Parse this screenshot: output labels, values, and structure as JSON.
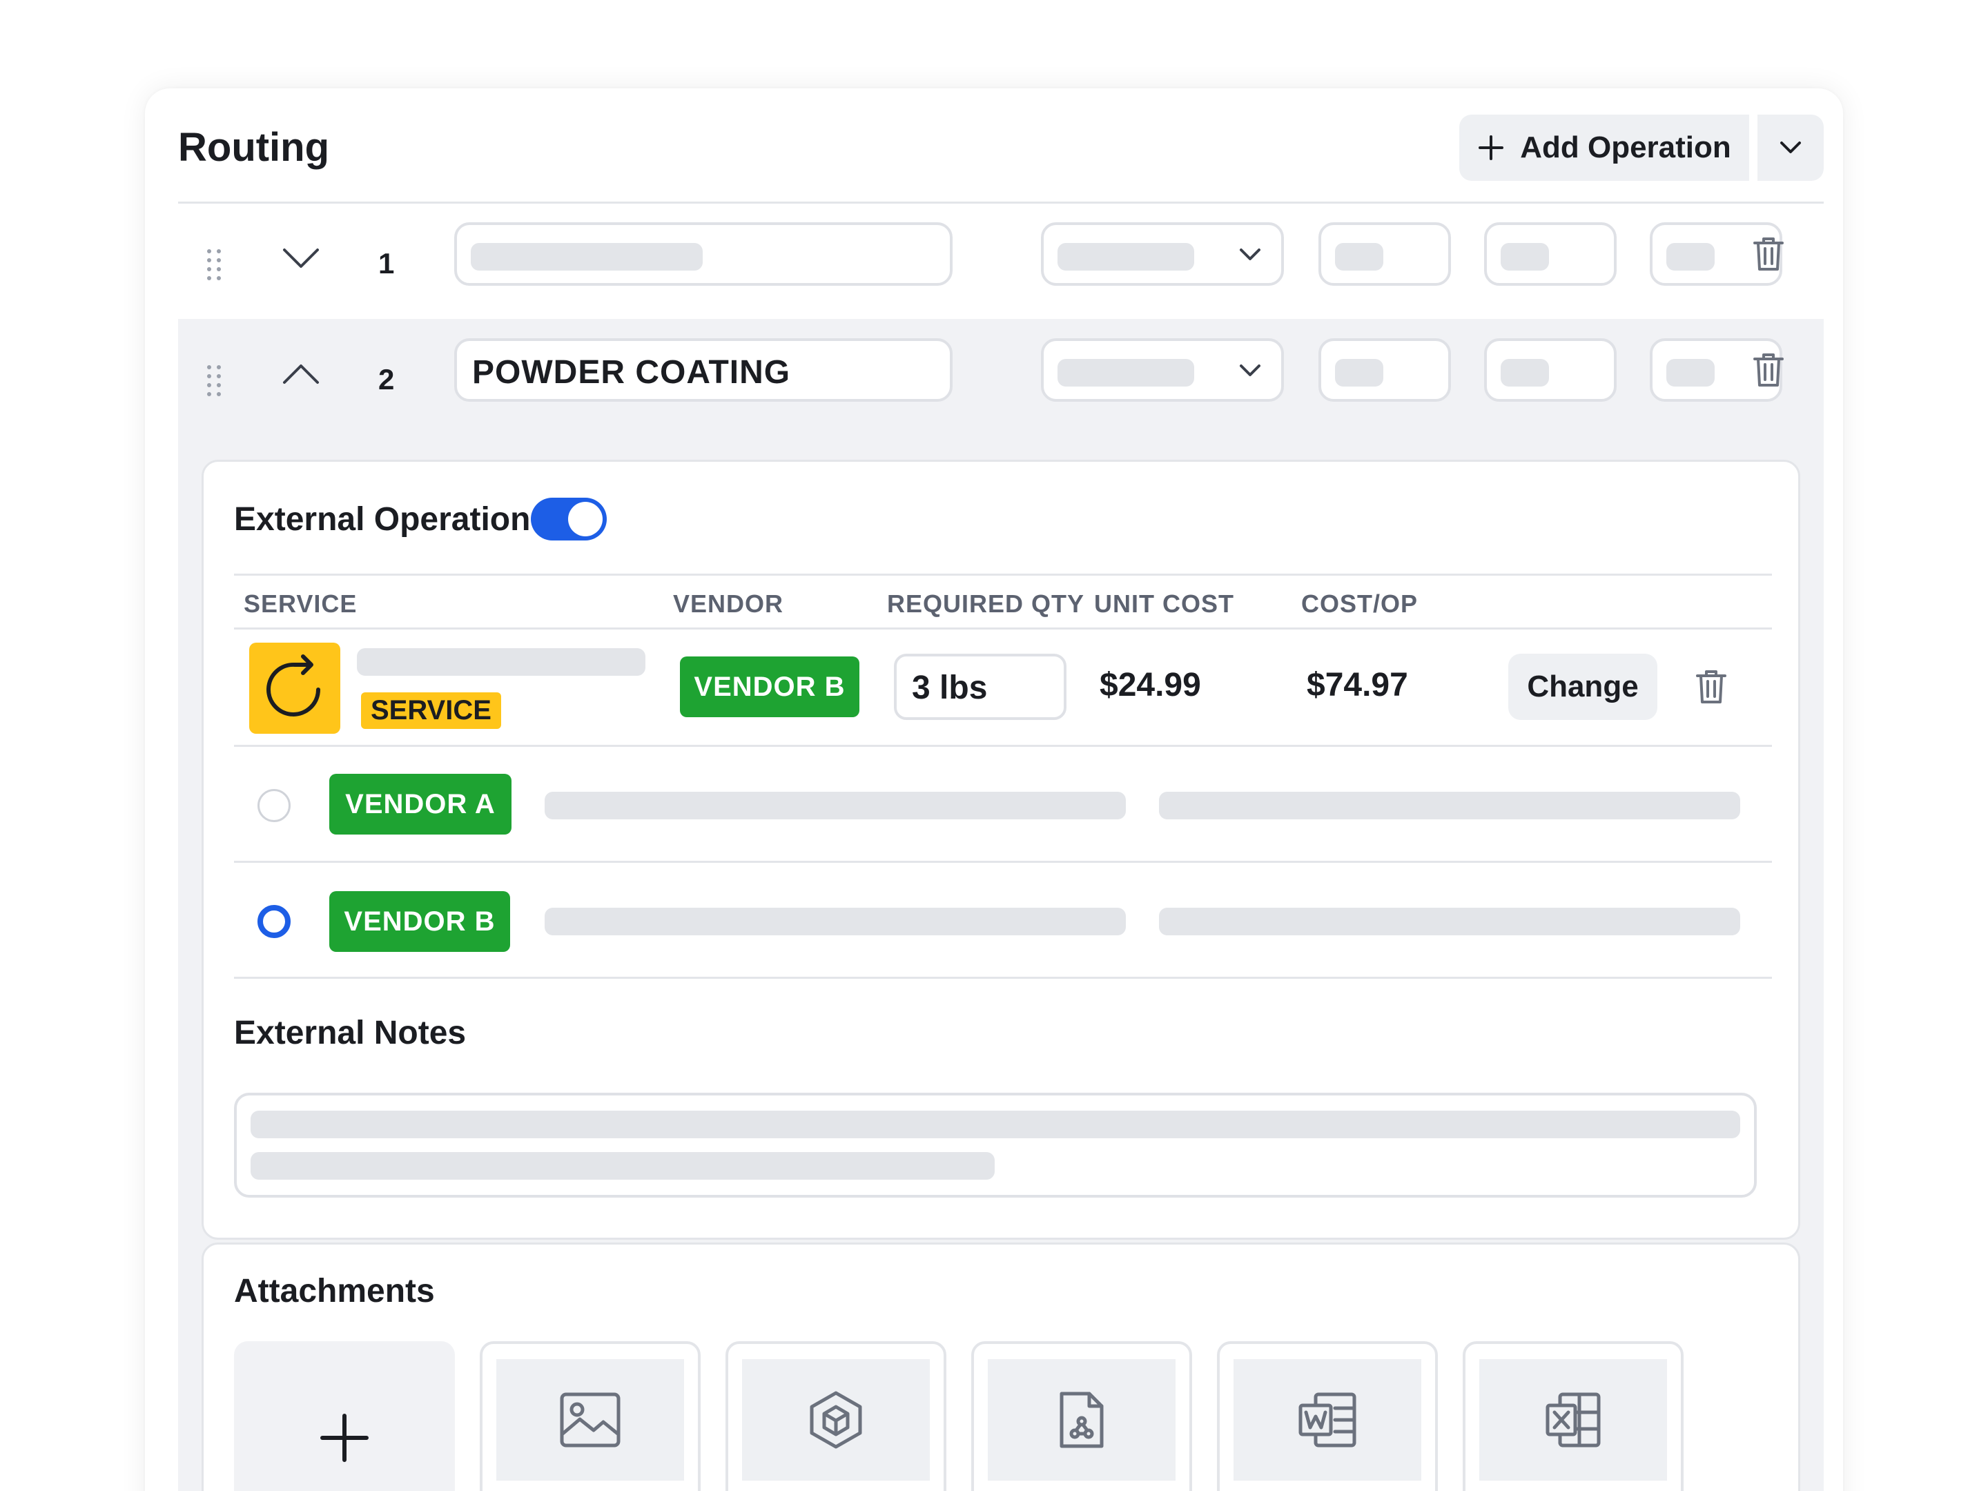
{
  "header": {
    "title": "Routing",
    "add_operation_label": "Add Operation"
  },
  "operations": [
    {
      "number": "1",
      "name": ""
    },
    {
      "number": "2",
      "name": "POWDER COATING"
    }
  ],
  "external": {
    "label": "External Operation",
    "enabled": true,
    "columns": [
      "SERVICE",
      "VENDOR",
      "REQUIRED QTY",
      "UNIT COST",
      "COST/OP"
    ],
    "service_badge": "SERVICE",
    "selected_vendor": "VENDOR B",
    "required_qty": "3 lbs",
    "unit_cost": "$24.99",
    "cost_op": "$74.97",
    "change_label": "Change",
    "vendor_options": [
      {
        "label": "VENDOR A",
        "selected": false
      },
      {
        "label": "VENDOR B",
        "selected": true
      }
    ]
  },
  "notes": {
    "label": "External Notes"
  },
  "attachments": {
    "label": "Attachments",
    "tiles": [
      "image-icon",
      "cube-icon",
      "pdf-icon",
      "word-icon",
      "excel-icon"
    ]
  },
  "colors": {
    "accent": "#1d5ee6",
    "vendor_green": "#1ea332",
    "service_yellow": "#ffc51a"
  }
}
